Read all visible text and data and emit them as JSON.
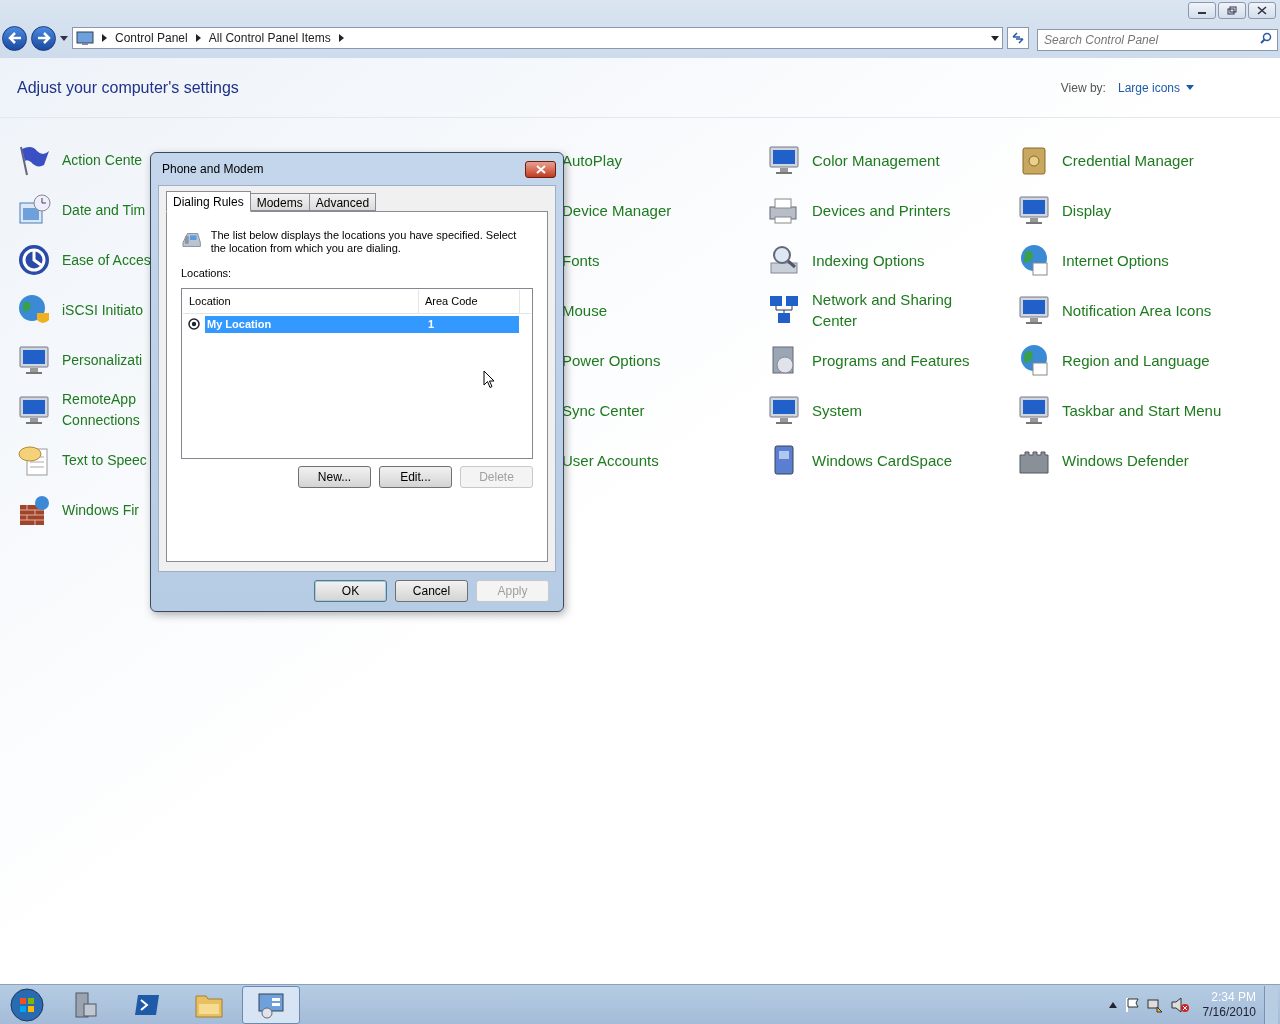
{
  "address_bar": {
    "breadcrumbs": [
      "Control Panel",
      "All Control Panel Items"
    ]
  },
  "search": {
    "placeholder": "Search Control Panel"
  },
  "header": {
    "title": "Adjust your computer's settings",
    "view_by_label": "View by:",
    "view_by_value": "Large icons"
  },
  "columns": [
    {
      "items": [
        {
          "label": "Action Cente"
        },
        {
          "label": "Date and Tim"
        },
        {
          "label": "Ease of Acces"
        },
        {
          "label": "iSCSI Initiato"
        },
        {
          "label": "Personalizati"
        },
        {
          "label": "RemoteApp",
          "label_line2": "Connections"
        },
        {
          "label": "Text to Speec"
        },
        {
          "label": "Windows Fir"
        }
      ]
    },
    {
      "items": [
        {
          "label": "AutoPlay"
        },
        {
          "label": "Device Manager"
        },
        {
          "label": "Fonts"
        },
        {
          "label": "Mouse"
        },
        {
          "label": "Power Options"
        },
        {
          "label": "Sync Center"
        },
        {
          "label": "User Accounts"
        }
      ]
    },
    {
      "items": [
        {
          "label": "Color Management"
        },
        {
          "label": "Devices and Printers"
        },
        {
          "label": "Indexing Options"
        },
        {
          "label": "Network and Sharing",
          "label_line2": "Center"
        },
        {
          "label": "Programs and Features"
        },
        {
          "label": "System"
        },
        {
          "label": "Windows CardSpace"
        }
      ]
    },
    {
      "items": [
        {
          "label": "Credential Manager"
        },
        {
          "label": "Display"
        },
        {
          "label": "Internet Options"
        },
        {
          "label": "Notification Area Icons"
        },
        {
          "label": "Region and Language"
        },
        {
          "label": "Taskbar and Start Menu"
        },
        {
          "label": "Windows Defender"
        }
      ]
    }
  ],
  "dialog": {
    "title": "Phone and Modem",
    "tabs": [
      {
        "label": "Dialing Rules",
        "selected": true
      },
      {
        "label": "Modems",
        "selected": false
      },
      {
        "label": "Advanced",
        "selected": false
      }
    ],
    "description": "The list below displays the locations you have specified. Select the location from which you are dialing.",
    "list_label": "Locations:",
    "table": {
      "columns": [
        "Location",
        "Area Code"
      ],
      "rows": [
        {
          "location": "My Location",
          "area_code": "1",
          "selected": true,
          "current": true
        }
      ]
    },
    "list_buttons": [
      {
        "label": "New...",
        "disabled": false
      },
      {
        "label": "Edit...",
        "disabled": false
      },
      {
        "label": "Delete",
        "disabled": true
      }
    ],
    "footer_buttons": [
      {
        "label": "OK",
        "disabled": false,
        "default": true
      },
      {
        "label": "Cancel",
        "disabled": false,
        "default": false
      },
      {
        "label": "Apply",
        "disabled": true,
        "default": false
      }
    ]
  },
  "taskbar": {
    "apps": [
      {
        "selected": false
      },
      {
        "selected": false
      },
      {
        "selected": false
      },
      {
        "selected": true
      }
    ],
    "time": "2:34 PM",
    "date": "7/16/2010"
  }
}
